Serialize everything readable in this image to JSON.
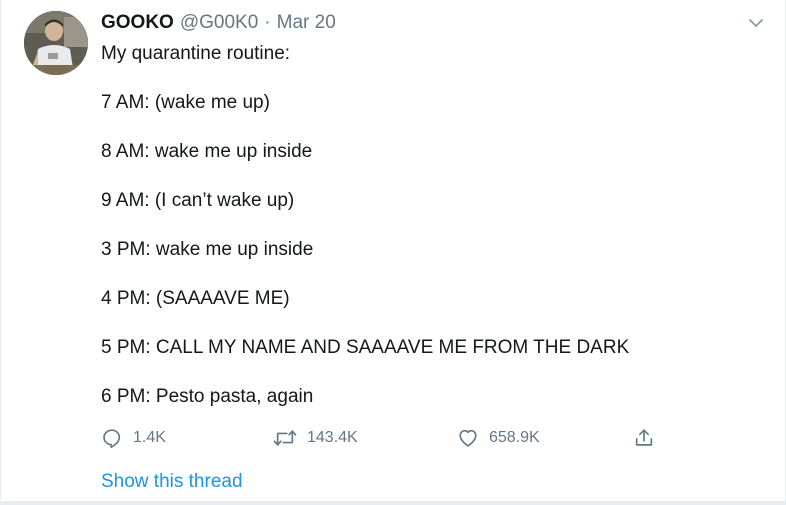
{
  "tweet": {
    "author_name": "GOOKO",
    "author_handle": "@G00K0",
    "separator": "·",
    "date": "Mar 20",
    "lines": [
      "My quarantine routine:",
      "7 AM: (wake me up)",
      "8 AM: wake me up inside",
      "9 AM: (I can’t wake up)",
      "3 PM: wake me up inside",
      "4 PM: (SAAAAVE ME)",
      "5 PM: CALL MY NAME AND SAAAAVE ME FROM THE DARK",
      "6 PM: Pesto pasta, again"
    ],
    "actions": {
      "reply_count": "1.4K",
      "retweet_count": "143.4K",
      "like_count": "658.9K"
    },
    "show_thread_label": "Show this thread"
  },
  "icons": {
    "reply": "reply-icon",
    "retweet": "retweet-icon",
    "like": "heart-icon",
    "share": "share-icon",
    "menu": "chevron-down-icon"
  },
  "colors": {
    "text": "#14171a",
    "secondary": "#657786",
    "link": "#1b95e0",
    "border": "#e6ecf0"
  }
}
